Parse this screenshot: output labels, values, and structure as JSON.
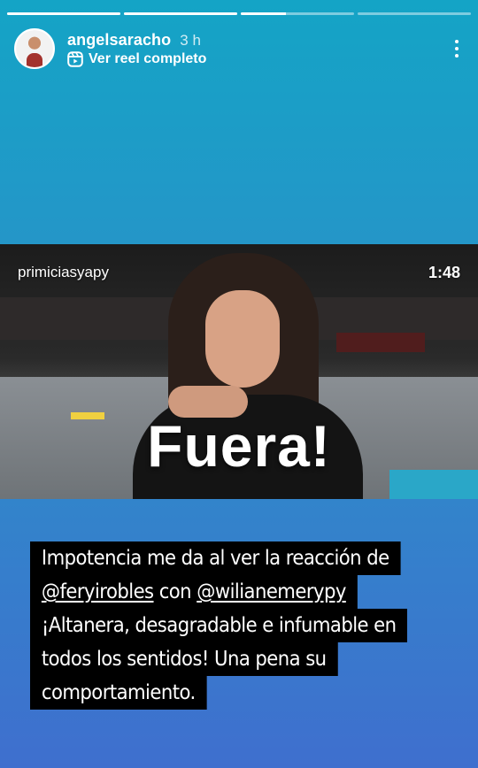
{
  "progress": {
    "segments": [
      1.0,
      1.0,
      0.4,
      0.0
    ]
  },
  "header": {
    "username": "angelsaracho",
    "time": "3 h",
    "reel_label": "Ver reel completo"
  },
  "video": {
    "source": "primiciasyapy",
    "duration": "1:48",
    "caption": "Fuera!"
  },
  "story_text": {
    "line1": "Impotencia me da al ver la reacción de",
    "line2_mention1": "@feryirobles",
    "line2_mid": " con ",
    "line2_mention2": "@wilianemerypy",
    "line3": "¡Altanera, desagradable e infumable en",
    "line4": "todos los sentidos! Una pena su",
    "line5": "comportamiento."
  },
  "colors": {
    "bg_top": "#14a4c6",
    "bg_bottom": "#3f6fce",
    "caption_bg": "#000000"
  }
}
